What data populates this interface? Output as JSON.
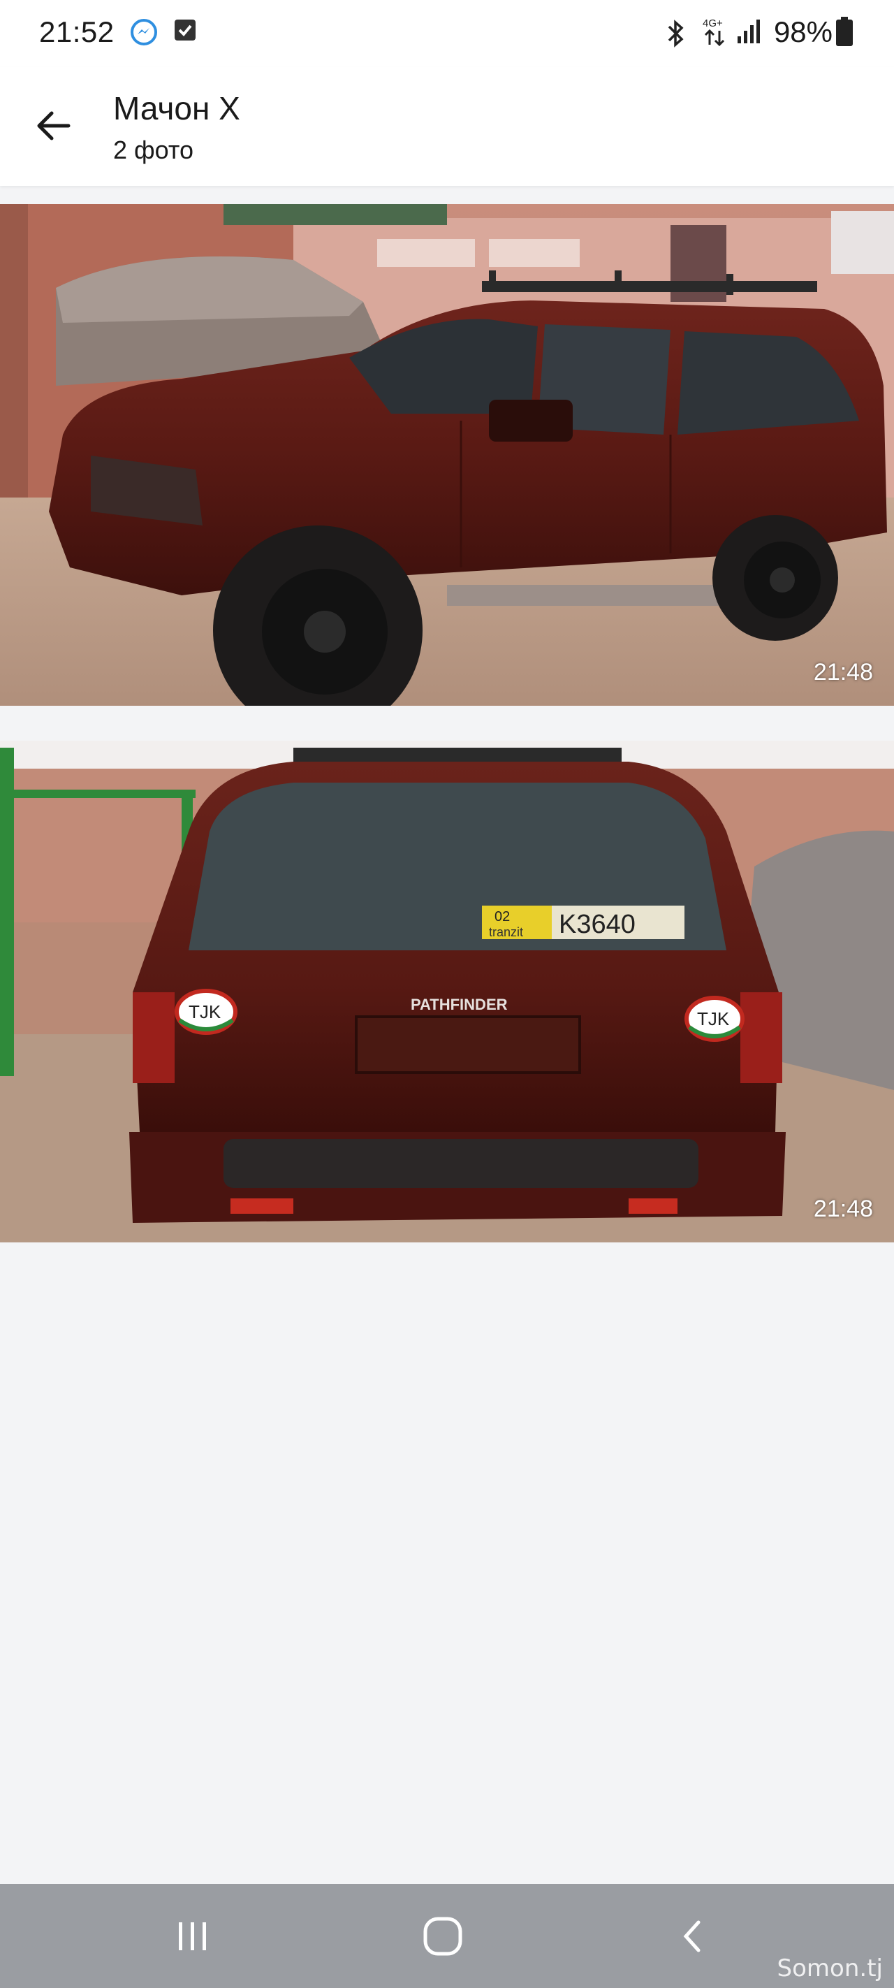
{
  "status_bar": {
    "time": "21:52",
    "network": "4G+",
    "battery": "98%",
    "icons": [
      "messenger-icon",
      "checkbox-notification-icon",
      "bluetooth-icon",
      "data-arrows-icon",
      "signal-icon",
      "battery-icon"
    ]
  },
  "header": {
    "title": "Мачон Х",
    "subtitle": "2 фото"
  },
  "photos": [
    {
      "time": "21:48"
    },
    {
      "time": "21:48"
    }
  ],
  "photo_text": {
    "model_badge": "PATHFINDER",
    "sticker": "TJK",
    "plate_region": "02",
    "plate_number": "K3640",
    "plate_tag": "tranzit"
  },
  "nav_bar": {
    "buttons": [
      "recent-apps-icon",
      "home-icon",
      "back-icon"
    ]
  },
  "watermark": "Somon.tj",
  "colors": {
    "header_bg": "#ffffff",
    "page_bg": "#f3f4f6",
    "nav_bg": "#9a9da2",
    "car_body": "#5a1a14"
  }
}
